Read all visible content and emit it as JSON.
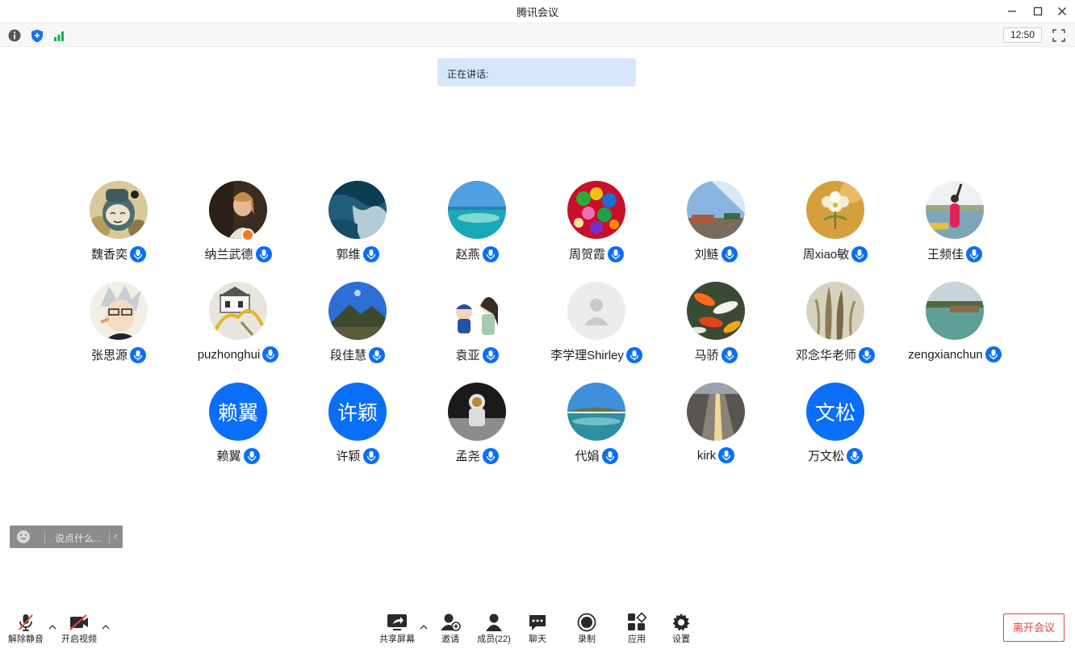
{
  "window": {
    "title": "腾讯会议"
  },
  "infobar": {
    "time": "12:50"
  },
  "speaking": {
    "label": "正在讲话:"
  },
  "participants": [
    {
      "name": "魏香奕"
    },
    {
      "name": "纳兰武德"
    },
    {
      "name": "郭维"
    },
    {
      "name": "赵燕"
    },
    {
      "name": "周贺霞"
    },
    {
      "name": "刘鲢"
    },
    {
      "name": "周xiao敏"
    },
    {
      "name": "王频佳"
    },
    {
      "name": "张思源"
    },
    {
      "name": "puzhonghui"
    },
    {
      "name": "段佳慧"
    },
    {
      "name": "袁亚"
    },
    {
      "name": "李学理Shirley"
    },
    {
      "name": "马骄"
    },
    {
      "name": "邓念华老师"
    },
    {
      "name": "zengxianchun"
    },
    {
      "name": "赖翼",
      "avatar_text": "赖翼"
    },
    {
      "name": "许颖",
      "avatar_text": "许颖"
    },
    {
      "name": "孟尧"
    },
    {
      "name": "代娟"
    },
    {
      "name": "kirk"
    },
    {
      "name": "万文松",
      "avatar_text": "文松"
    }
  ],
  "chat": {
    "placeholder": "说点什么..."
  },
  "toolbar": {
    "unmute": "解除静音",
    "start_video": "开启视频",
    "share_screen": "共享屏幕",
    "invite": "邀请",
    "members": "成员(22)",
    "chat": "聊天",
    "record": "录制",
    "apps": "应用",
    "settings": "设置",
    "leave": "离开会议"
  },
  "colors": {
    "accent": "#0a6ef8",
    "danger": "#e0463d",
    "speaking_bg": "#d6e6fb"
  }
}
